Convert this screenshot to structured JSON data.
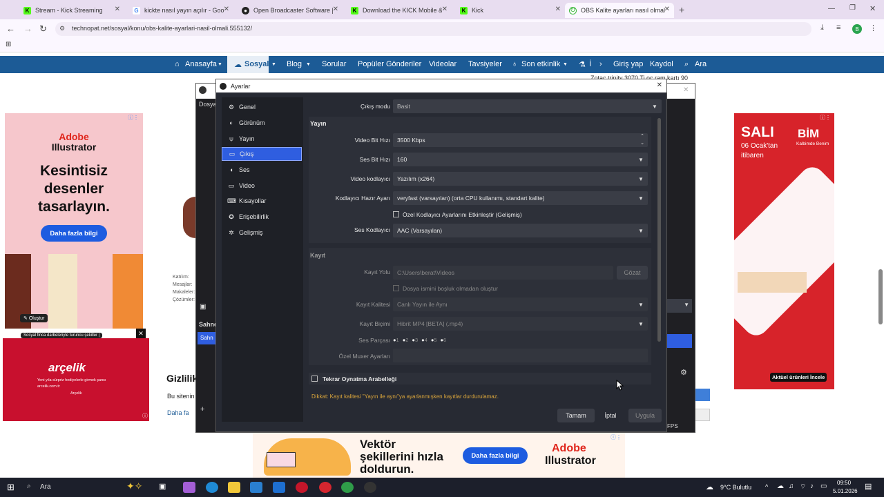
{
  "browser": {
    "tabs": [
      {
        "label": "Stream - Kick Streaming",
        "icon": "kick-icon"
      },
      {
        "label": "kickte nasıl yayın açılır - Google",
        "icon": "google-icon"
      },
      {
        "label": "Open Broadcaster Software | O",
        "icon": "obs-icon"
      },
      {
        "label": "Download the KICK Mobile & ",
        "icon": "kick-icon"
      },
      {
        "label": "Kick",
        "icon": "kick-icon"
      },
      {
        "label": "OBS Kalite ayarları nasıl olmalı",
        "icon": "technopat-icon"
      }
    ],
    "url": "technopat.net/sosyal/konu/obs-kalite-ayarlari-nasil-olmali.555132/",
    "profile_letter": "B"
  },
  "site_nav": {
    "items": [
      "Anasayfa",
      "Sosyal",
      "Blog",
      "Sorular",
      "Popüler Gönderiler",
      "Videolar",
      "Tavsiyeler",
      "Son etkinlik",
      "İ",
      "Giriş yap",
      "Kaydol",
      "Ara"
    ]
  },
  "ads": {
    "left": {
      "brand1": "Adobe",
      "brand2": "Illustrator",
      "line1": "Kesintisiz",
      "line2": "desenler",
      "line3": "tasarlayın.",
      "cta": "Daha fazla bilgi",
      "badge": "Oluştur"
    },
    "left_caption": "Sosyal finca darbeleriyle turuncu şekiller |",
    "arcelik": {
      "brand": "arçelik",
      "text": "Yeni yıla sürpriz hediyelerle girmek şansı",
      "url": "arcelik.com.tr",
      "sub": "Arçelik"
    },
    "right": {
      "line1": "SALI",
      "line2": "06 Ocak'tan",
      "line3": "itibaren",
      "brand": "BİM",
      "slogan": "Kalbimde Benim",
      "cta": "Aktüel ürünleri İncele"
    },
    "bottom": {
      "line1": "Vektör",
      "line2": "şekillerini hızla",
      "line3": "doldurun.",
      "cta": "Daha fazla bilgi",
      "brand1": "Adobe",
      "brand2": "Illustrator"
    }
  },
  "page_bg": {
    "trending": "Zotac trinity 3070 Ti oc ram kartı 90",
    "stats": [
      "Katılım:",
      "Mesajlar:",
      "Makaleler:",
      "Çözümler:"
    ],
    "privacy_title": "Gizlilik",
    "privacy_text": "Bu sitenin",
    "privacy_link": "Daha fa",
    "obs_file": "Dosya",
    "scene_label": "Sahne",
    "scene_item": "Sahn",
    "fps": "FPS"
  },
  "dialog": {
    "title": "Ayarlar",
    "sidebar": [
      "Genel",
      "Görünüm",
      "Yayın",
      "Çıkış",
      "Ses",
      "Video",
      "Kısayollar",
      "Erişebilirlik",
      "Gelişmiş"
    ],
    "output_mode_label": "Çıkış modu",
    "output_mode_value": "Basit",
    "stream_section": "Yayın",
    "video_bitrate_label": "Video Bit Hızı",
    "video_bitrate_value": "3500 Kbps",
    "audio_bitrate_label": "Ses Bit Hızı",
    "audio_bitrate_value": "160",
    "video_encoder_label": "Video kodlayıcı",
    "video_encoder_value": "Yazılım (x264)",
    "encoder_preset_label": "Kodlayıcı Hazır Ayarı",
    "encoder_preset_value": "veryfast (varsayılan) (orta CPU kullanımı, standart kalite)",
    "custom_encoder_label": "Özel Kodlayıcı Ayarlarını Etkinleştir (Gelişmiş)",
    "audio_encoder_label": "Ses Kodlayıcı",
    "audio_encoder_value": "AAC (Varsayılan)",
    "record_section": "Kayıt",
    "record_path_label": "Kayıt Yolu",
    "record_path_value": "C:\\Users\\berat\\Videos",
    "browse_label": "Gözat",
    "no_space_label": "Dosya ismini boşluk olmadan oluştur",
    "record_quality_label": "Kayıt Kalitesi",
    "record_quality_value": "Canlı Yayın ile Aynı",
    "record_format_label": "Kayıt Biçimi",
    "record_format_value": "Hibrit MP4 [BETA] (.mp4)",
    "audio_tracks_label": "Ses Parçası",
    "audio_tracks": [
      "1",
      "2",
      "3",
      "4",
      "5",
      "6"
    ],
    "muxer_label": "Özel Muxer Ayarları",
    "replay_buffer_label": "Tekrar Oynatma Arabelleği",
    "warning": "Dikkat: Kayıt kalitesi \"Yayın ile aynı\"ya ayarlanmışken kayıtlar durdurulamaz.",
    "ok_label": "Tamam",
    "cancel_label": "İptal",
    "apply_label": "Uygula"
  },
  "taskbar": {
    "search": "Ara",
    "weather": "9°C Bulutlu",
    "time": "09:50",
    "date": "5.01.2026"
  }
}
